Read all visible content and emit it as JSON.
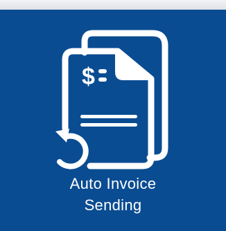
{
  "tile": {
    "label_line1": "Auto Invoice",
    "label_line2": "Sending",
    "icon": "invoice-auto-send-icon",
    "currency_symbol": "$",
    "background_color": "#0a4c92",
    "foreground_color": "#ffffff"
  }
}
